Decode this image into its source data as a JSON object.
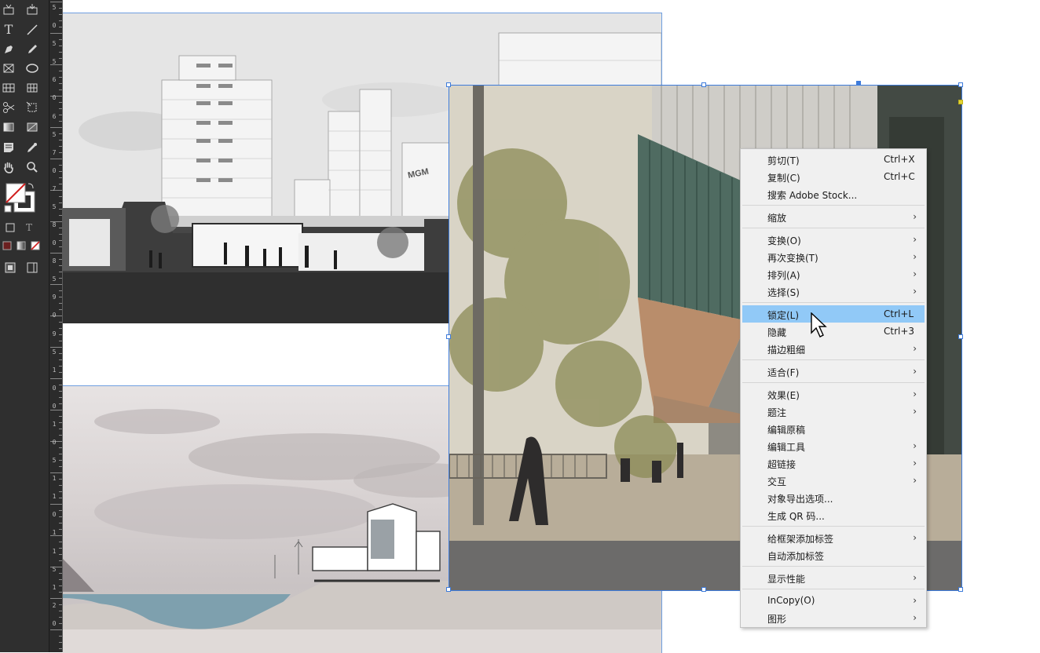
{
  "tools_panel": {
    "tools": [
      {
        "name": "content-grabber-icon"
      },
      {
        "name": "content-placer-icon"
      },
      {
        "name": "type-tool-icon",
        "glyph": "T"
      },
      {
        "name": "line-tool-icon"
      },
      {
        "name": "pen-tool-icon"
      },
      {
        "name": "pencil-tool-icon"
      },
      {
        "name": "rectangle-frame-icon"
      },
      {
        "name": "ellipse-tool-icon"
      },
      {
        "name": "table-icon"
      },
      {
        "name": "grid-icon"
      },
      {
        "name": "scissors-icon"
      },
      {
        "name": "free-transform-icon"
      },
      {
        "name": "gradient-swatch-icon"
      },
      {
        "name": "gradient-feather-icon"
      },
      {
        "name": "note-tool-icon"
      },
      {
        "name": "eyedropper-icon"
      },
      {
        "name": "hand-tool-icon"
      },
      {
        "name": "zoom-tool-icon"
      },
      {
        "name": "fill-stroke-swatch-icon"
      },
      {
        "name": "formatting-container-icon"
      },
      {
        "name": "formatting-text-icon",
        "glyph": "T"
      },
      {
        "name": "apply-color-icon"
      },
      {
        "name": "apply-gradient-icon"
      },
      {
        "name": "apply-none-icon"
      },
      {
        "name": "normal-view-icon"
      },
      {
        "name": "screen-mode-icon"
      }
    ]
  },
  "ruler": {
    "labels": [
      "5",
      "0",
      "5",
      "5",
      "6",
      "0",
      "6",
      "5",
      "7",
      "0",
      "7",
      "5",
      "8",
      "0",
      "8",
      "5",
      "9",
      "0",
      "9",
      "5",
      "1",
      "0",
      "0",
      "1",
      "0",
      "5",
      "1",
      "1",
      "0",
      "1",
      "1",
      "5",
      "1",
      "2",
      "0"
    ]
  },
  "context_menu": {
    "items": [
      {
        "label": "剪切(T)",
        "shortcut": "Ctrl+X"
      },
      {
        "label": "复制(C)",
        "shortcut": "Ctrl+C"
      },
      {
        "label": "搜索 Adobe Stock..."
      },
      {
        "label": "缩放",
        "submenu": true
      },
      {
        "label": "变换(O)",
        "submenu": true
      },
      {
        "label": "再次变换(T)",
        "submenu": true
      },
      {
        "label": "排列(A)",
        "submenu": true
      },
      {
        "label": "选择(S)",
        "submenu": true
      },
      {
        "label": "锁定(L)",
        "shortcut": "Ctrl+L",
        "highlighted": true
      },
      {
        "label": "隐藏",
        "shortcut": "Ctrl+3"
      },
      {
        "label": "描边粗细",
        "submenu": true
      },
      {
        "label": "适合(F)",
        "submenu": true
      },
      {
        "label": "效果(E)",
        "submenu": true
      },
      {
        "label": "题注",
        "submenu": true
      },
      {
        "label": "编辑原稿"
      },
      {
        "label": "编辑工具",
        "submenu": true
      },
      {
        "label": "超链接",
        "submenu": true
      },
      {
        "label": "交互",
        "submenu": true
      },
      {
        "label": "对象导出选项..."
      },
      {
        "label": "生成 QR 码..."
      },
      {
        "label": "给框架添加标签",
        "submenu": true
      },
      {
        "label": "自动添加标签"
      },
      {
        "label": "显示性能",
        "submenu": true
      },
      {
        "label": "InCopy(O)",
        "submenu": true
      },
      {
        "label": "图形",
        "submenu": true
      }
    ],
    "submenu_arrow": "›"
  },
  "canvas_text": {
    "mgm_sign": "MGM"
  },
  "colors": {
    "tools_bg": "#2f2f2f",
    "menu_bg": "#f0f0f0",
    "menu_highlight": "#91c9f7",
    "selection_blue": "#3d7bdb",
    "swatch_red": "#d11f1f"
  }
}
